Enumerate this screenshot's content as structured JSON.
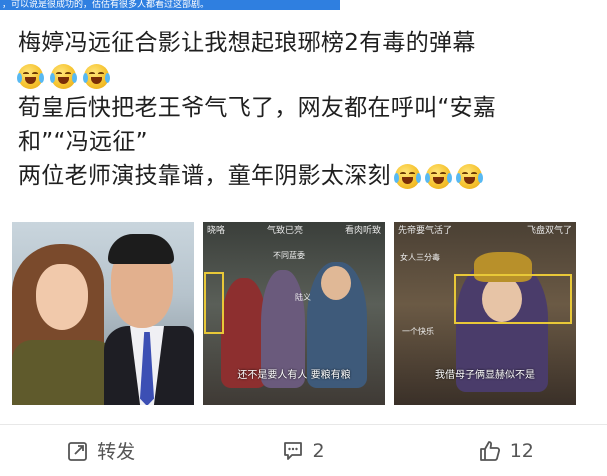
{
  "banner": {
    "text": "，可以说是很成功的，估估有很多人都看过这部剧。"
  },
  "post": {
    "line1": "梅婷冯远征合影让我想起琅琊榜2有毒的弹幕",
    "line2": "荀皇后快把老王爷气飞了，网友都在呼叫“安嘉",
    "line3": "和”“冯远征”",
    "line4": "两位老师演技靠谱，童年阴影太深刻",
    "emoji_name": "laughing-tears-emoji"
  },
  "photos": [
    {
      "kind": "selfie"
    },
    {
      "kind": "drama-still",
      "top_text": [
        "晓咯",
        "气致已亮",
        "看肉听致"
      ],
      "subtitle": "还不是要人有人 要粮有粮"
    },
    {
      "kind": "drama-still",
      "top_text": [
        "先帝要气活了",
        "飞盘双气了"
      ],
      "subtitle": "我借母子俩显赫似不是"
    }
  ],
  "actions": {
    "repost_label": "转发",
    "comment_count": "2",
    "like_count": "12"
  },
  "colors": {
    "banner": "#2f7fe0",
    "highlight_box": "#e8c838"
  }
}
